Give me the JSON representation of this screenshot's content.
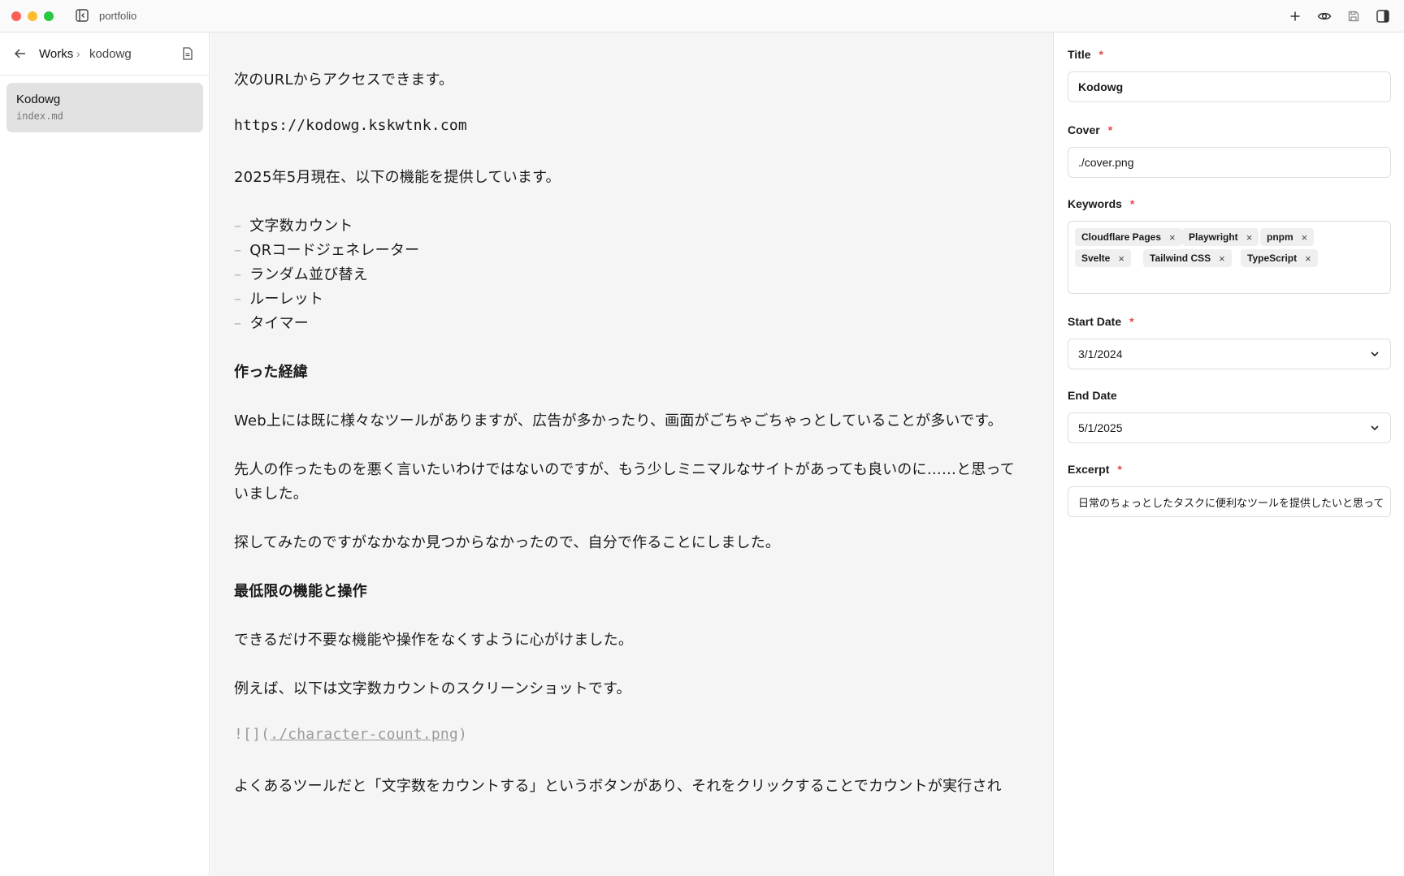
{
  "window": {
    "title": "portfolio"
  },
  "sidebar": {
    "breadcrumb": {
      "parent": "Works",
      "separator": "›",
      "current": "kodowg"
    },
    "files": [
      {
        "name": "Kodowg",
        "path": "index.md"
      }
    ]
  },
  "editor": {
    "lines": {
      "l1": "次のURLからアクセスできます。",
      "l2": "https://kodowg.kskwtnk.com",
      "l3": "2025年5月現在、以下の機能を提供しています。",
      "b1": "文字数カウント",
      "b2": "QRコードジェネレーター",
      "b3": "ランダム並び替え",
      "b4": "ルーレット",
      "b5": "タイマー",
      "h1": "作った経緯",
      "p1": "Web上には既に様々なツールがありますが、広告が多かったり、画面がごちゃごちゃっとしていることが多いです。",
      "p2a": "先人の作ったものを悪く言いたいわけではないのですが、もう少しミニマルなサイトがあっても良いのに……と思って",
      "p2b": "いました。",
      "p3": "探してみたのですがなかなか見つからなかったので、自分で作ることにしました。",
      "h2": "最低限の機能と操作",
      "p4": "できるだけ不要な機能や操作をなくすように心がけました。",
      "p5": "例えば、以下は文字数カウントのスクリーンショットです。",
      "img_prefix": "![](",
      "img_path": "./character-count.png",
      "img_suffix": ")",
      "p6": "よくあるツールだと「文字数をカウントする」というボタンがあり、それをクリックすることでカウントが実行され"
    },
    "bullet_marker": "–"
  },
  "form": {
    "title": {
      "label": "Title",
      "required": "*",
      "value": "Kodowg"
    },
    "cover": {
      "label": "Cover",
      "required": "*",
      "value": "./cover.png"
    },
    "keywords": {
      "label": "Keywords",
      "required": "*",
      "tags": [
        "Cloudflare Pages",
        "Playwright",
        "pnpm",
        "Svelte",
        "Tailwind CSS",
        "TypeScript"
      ],
      "remove_glyph": "×"
    },
    "start_date": {
      "label": "Start Date",
      "required": "*",
      "value": "3/1/2024"
    },
    "end_date": {
      "label": "End Date",
      "value": "5/1/2025"
    },
    "excerpt": {
      "label": "Excerpt",
      "required": "*",
      "value": "日常のちょっとしたタスクに便利なツールを提供したいと思って"
    }
  },
  "icons": {
    "toolbar": [
      "plus-icon",
      "eye-icon",
      "save-icon",
      "panel-right-icon"
    ],
    "accent_red": "#e5484d"
  }
}
